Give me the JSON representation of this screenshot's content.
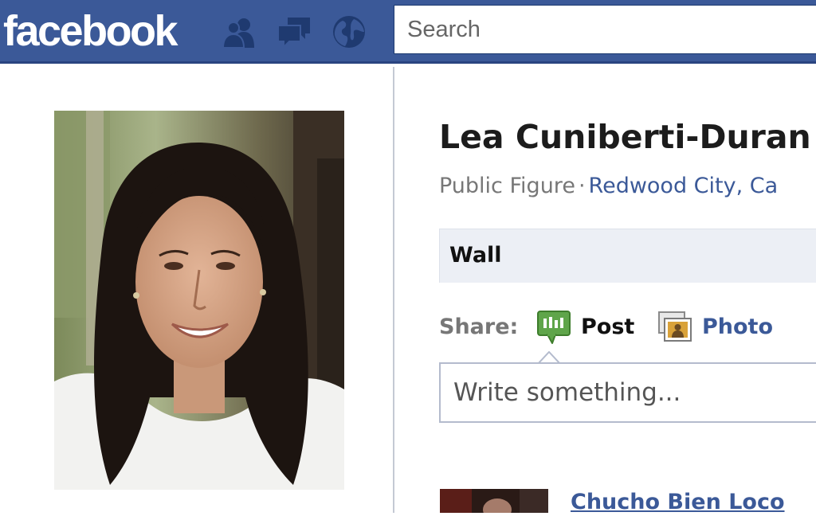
{
  "brand": {
    "logo_text": "facebook",
    "bar_color": "#3b5998"
  },
  "nav": {
    "icons": [
      "friends-icon",
      "messages-icon",
      "notifications-globe-icon"
    ]
  },
  "search": {
    "placeholder": "Search",
    "value": ""
  },
  "profile": {
    "name": "Lea Cuniberti-Duran",
    "category": "Public Figure",
    "separator": "·",
    "location": "Redwood City, Ca",
    "photo_icon": "profile-photo"
  },
  "tabs": {
    "active": "Wall"
  },
  "share": {
    "label": "Share:",
    "post_label": "Post",
    "photo_label": "Photo",
    "post_icon": "speech-bubble-icon",
    "photo_icon": "photo-icon"
  },
  "composer": {
    "placeholder": "Write something...",
    "value": ""
  },
  "feed": {
    "items": [
      {
        "author": "Chucho Bien Loco"
      }
    ]
  }
}
